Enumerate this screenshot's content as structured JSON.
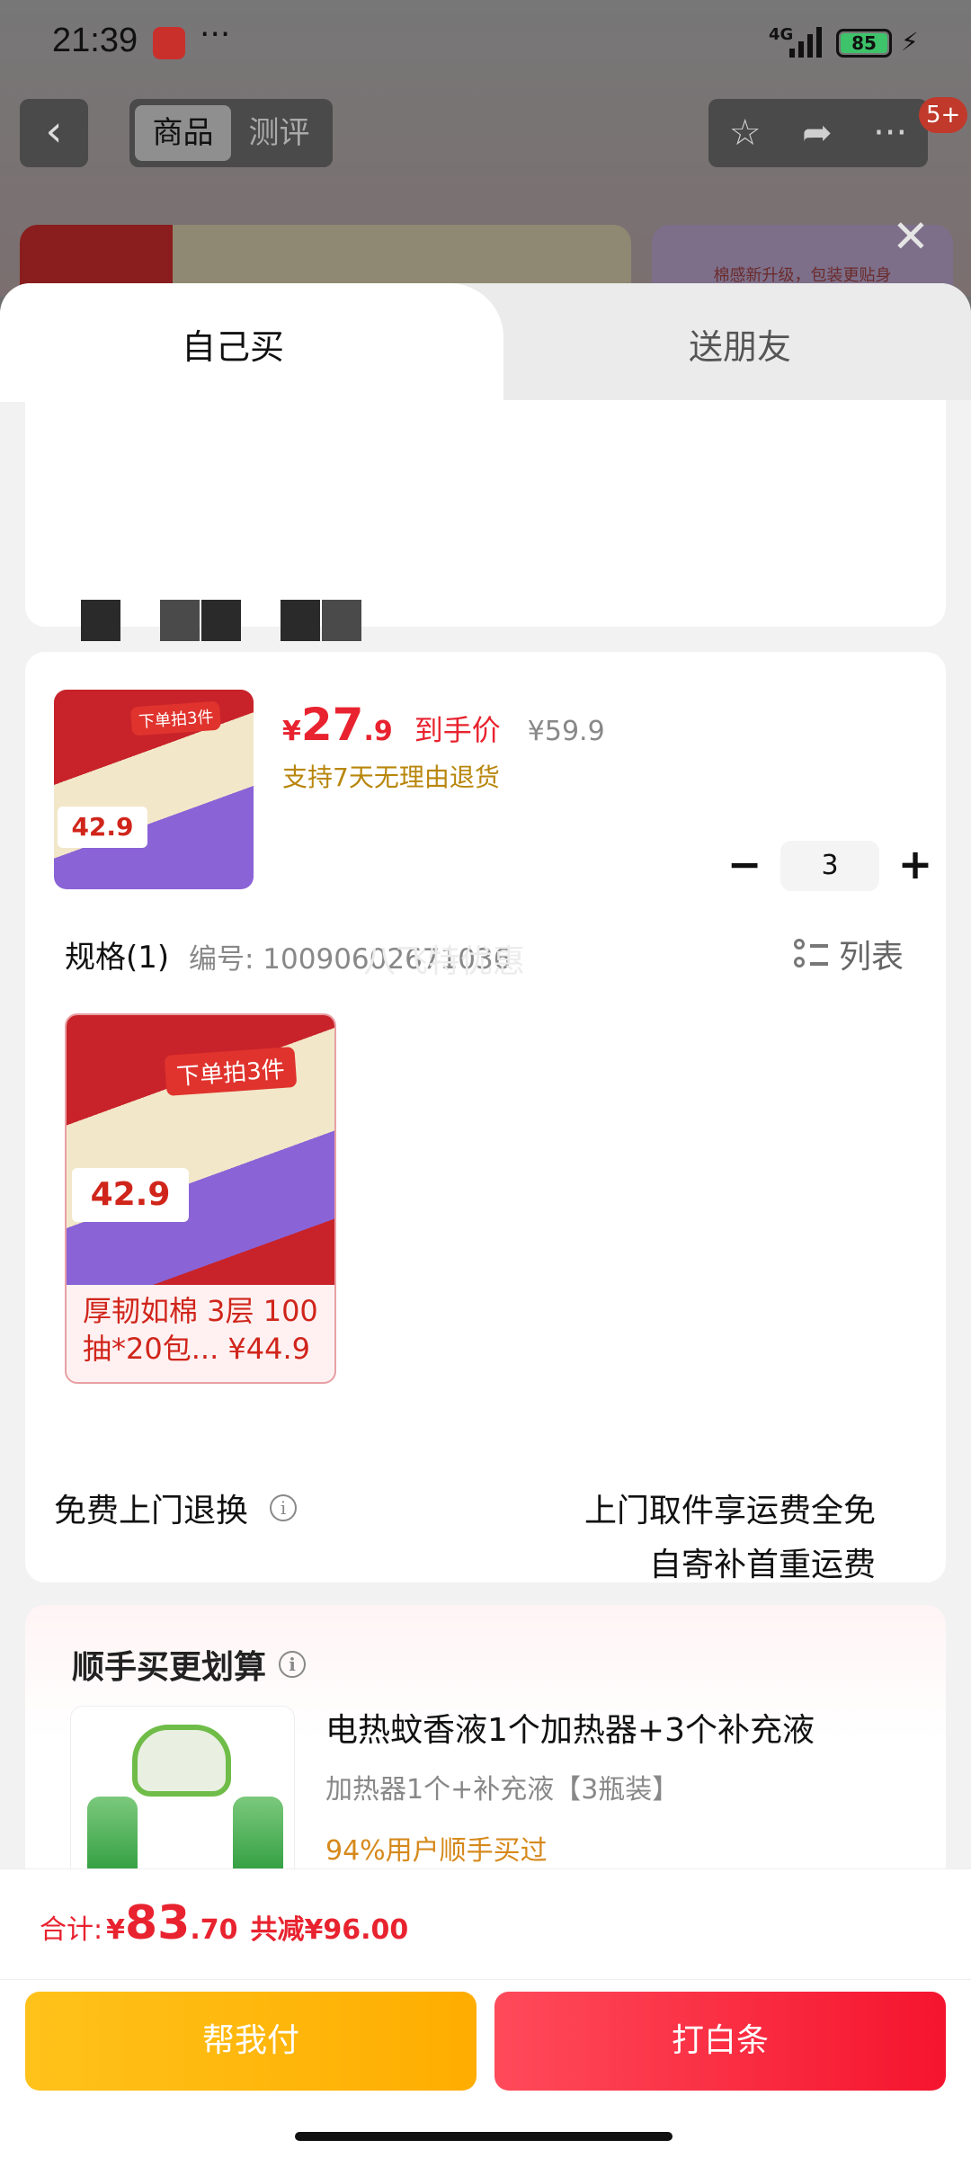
{
  "status_bar": {
    "time": "21:39",
    "more": "···",
    "network": "4G",
    "battery": "85"
  },
  "nav": {
    "back": "‹",
    "tabs": [
      "商品",
      "测评"
    ],
    "badge": "5+"
  },
  "banner": {
    "right_text": "棉感新升级，包装更贴身"
  },
  "sheet": {
    "tab_self": "自己买",
    "tab_friend": "送朋友"
  },
  "product": {
    "price_symbol": "¥",
    "price_main": "27",
    "price_decimal": ".9",
    "price_tag": "到手价",
    "original_price": "¥59.9",
    "return_note": "支持7天无理由退货",
    "quantity": "3",
    "minus": "−",
    "plus": "+",
    "thumb_label": "下单拍3件",
    "thumb_price": "42.9"
  },
  "spec": {
    "title": "规格(1)",
    "code": "编号: 10090602671036",
    "list_toggle": "列表",
    "item_name": "厚韧如棉 3层 100抽*20包...",
    "item_price": "¥44.9",
    "item_badge": "下单拍3件",
    "item_img_price": "42.9",
    "watermark": "八飞特优惠"
  },
  "service": {
    "label": "免费上门退换",
    "line1": "上门取件享运费全免",
    "line2": "自寄补首重运费"
  },
  "upsell": {
    "title": "顺手买更划算",
    "name": "电热蚊香液1个加热器+3个补充液",
    "spec": "加热器1个+补充液【3瓶装】",
    "stat": "94%用户顺手买过"
  },
  "footer": {
    "total_label": "合计:",
    "total_symbol": "¥",
    "total_main": "83",
    "total_decimal": ".70",
    "saving": "共减¥96.00",
    "btn_help": "帮我付",
    "btn_credit": "打白条"
  }
}
